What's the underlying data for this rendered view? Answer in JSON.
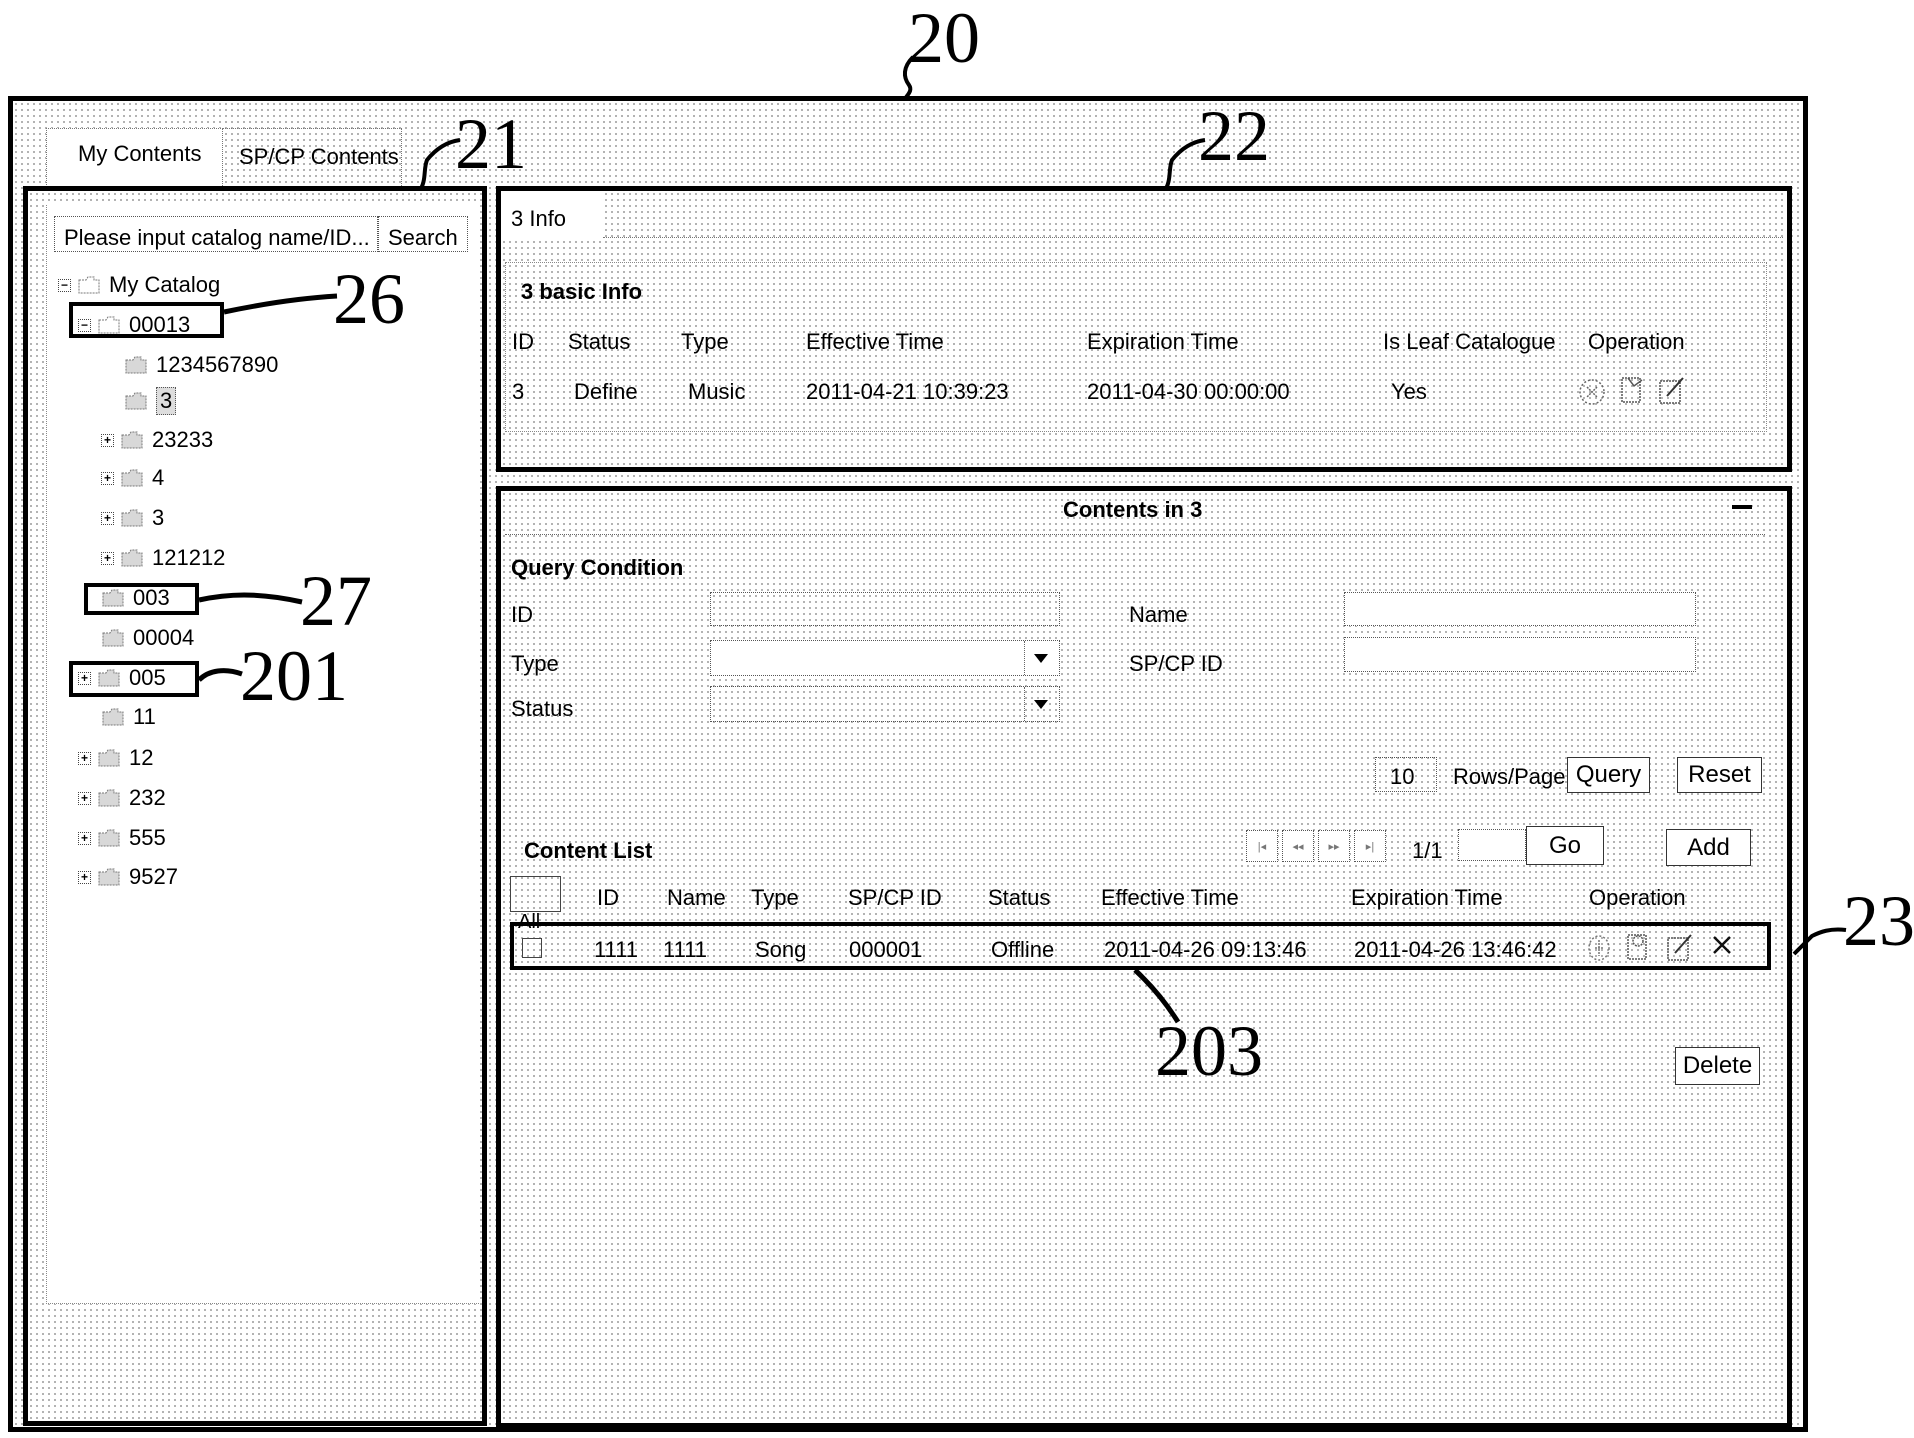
{
  "reference_labels": {
    "outer_window": "20",
    "left_panel": "21",
    "info_panel": "22",
    "contents_panel": "23",
    "expanded_node": "26",
    "leaf_node": "27",
    "collapsed_node": "201",
    "content_row": "203"
  },
  "tabs": [
    {
      "label": "My Contents",
      "active": true
    },
    {
      "label": "SP/CP Contents",
      "active": false
    }
  ],
  "catalog": {
    "search_placeholder": "Please input catalog name/ID...",
    "search_button": "Search",
    "tree": [
      {
        "label": "My Catalog",
        "toggle": "minus",
        "level": 0
      },
      {
        "label": "00013",
        "toggle": "minus",
        "level": 1
      },
      {
        "label": "1234567890",
        "toggle": "none",
        "level": 3
      },
      {
        "label": "3",
        "toggle": "none",
        "level": 3,
        "selected": true
      },
      {
        "label": "23233",
        "toggle": "plus",
        "level": 2
      },
      {
        "label": "4",
        "toggle": "plus",
        "level": 2
      },
      {
        "label": "3",
        "toggle": "plus",
        "level": 2
      },
      {
        "label": "121212",
        "toggle": "plus",
        "level": 2
      },
      {
        "label": "003",
        "toggle": "none",
        "level": 1
      },
      {
        "label": "00004",
        "toggle": "none",
        "level": 1
      },
      {
        "label": "005",
        "toggle": "plus",
        "level": 1
      },
      {
        "label": "11",
        "toggle": "none",
        "level": 1
      },
      {
        "label": "12",
        "toggle": "plus",
        "level": 1
      },
      {
        "label": "232",
        "toggle": "plus",
        "level": 1
      },
      {
        "label": "555",
        "toggle": "plus",
        "level": 1
      },
      {
        "label": "9527",
        "toggle": "plus",
        "level": 1
      }
    ]
  },
  "info": {
    "tab_label": "3 Info",
    "section_title": "3 basic Info",
    "columns": [
      "ID",
      "Status",
      "Type",
      "Effective Time",
      "Expiration Time",
      "Is Leaf Catalogue",
      "Operation"
    ],
    "row": {
      "id": "3",
      "status": "Define",
      "type": "Music",
      "effective_time": "2011-04-21 10:39:23",
      "expiration_time": "2011-04-30 00:00:00",
      "is_leaf": "Yes",
      "operations": [
        "disable-icon",
        "publish-icon",
        "edit-icon"
      ]
    }
  },
  "contents": {
    "title": "Contents in 3",
    "collapse_icon": "minimize-icon",
    "query": {
      "title": "Query Condition",
      "id_label": "ID",
      "id_value": "",
      "name_label": "Name",
      "name_value": "",
      "type_label": "Type",
      "type_value": "",
      "spcp_label": "SP/CP ID",
      "spcp_value": "",
      "status_label": "Status",
      "status_value": "",
      "rows_per_page_value": "10",
      "rows_per_page_label": "Rows/Page",
      "query_button": "Query",
      "reset_button": "Reset"
    },
    "list": {
      "title": "Content List",
      "pagination": {
        "icons": [
          "first-page-icon",
          "prev-page-icon",
          "next-page-icon",
          "last-page-icon"
        ],
        "page_info": "1/1",
        "goto_value": "",
        "go_button": "Go"
      },
      "add_button": "Add",
      "select_all_label": "All",
      "columns": [
        "ID",
        "Name",
        "Type",
        "SP/CP ID",
        "Status",
        "Effective Time",
        "Expiration Time",
        "Operation"
      ],
      "rows": [
        {
          "checked": false,
          "id": "1111",
          "name": "1111",
          "type": "Song",
          "spcp_id": "000001",
          "status": "Offline",
          "effective_time": "2011-04-26 09:13:46",
          "expiration_time": "2011-04-26 13:46:42",
          "operations": [
            "online-icon",
            "publish-icon",
            "edit-icon",
            "delete-x-icon"
          ]
        }
      ],
      "delete_button": "Delete"
    }
  }
}
